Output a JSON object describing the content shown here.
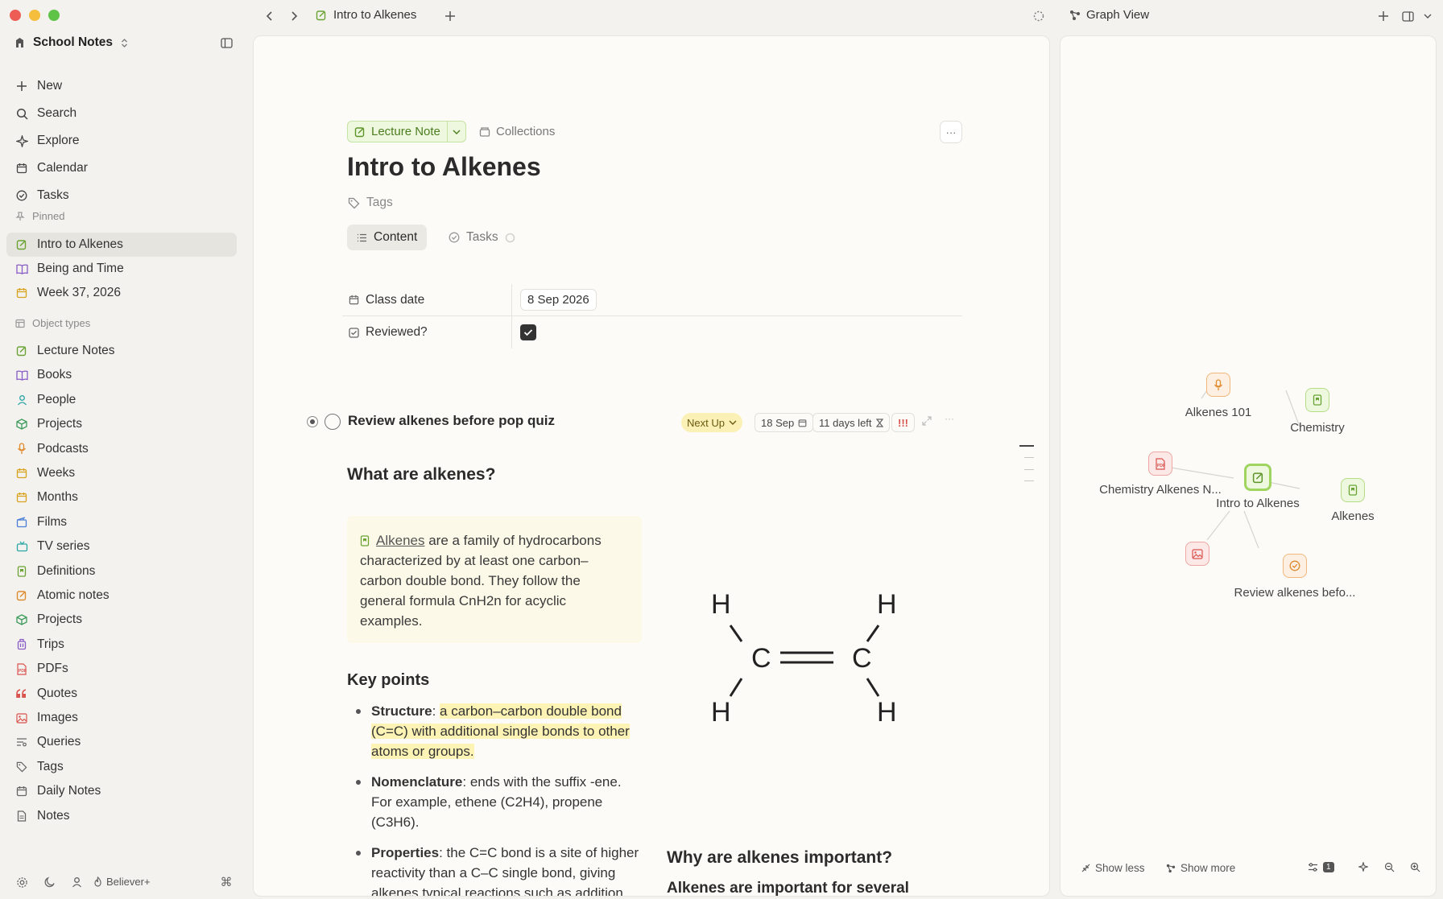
{
  "window": {
    "tab_title": "Intro to Alkenes",
    "graph_title": "Graph View"
  },
  "sidebar": {
    "workspace": "School Notes",
    "top_items": [
      {
        "label": "New",
        "icon": "plus-icon"
      },
      {
        "label": "Search",
        "icon": "search-icon"
      },
      {
        "label": "Explore",
        "icon": "sparkle-icon"
      },
      {
        "label": "Calendar",
        "icon": "calendar-icon"
      },
      {
        "label": "Tasks",
        "icon": "check-circle-icon"
      }
    ],
    "pinned_label": "Pinned",
    "pinned": [
      {
        "label": "Intro to Alkenes",
        "icon": "note-icon",
        "color": "#6aa334"
      },
      {
        "label": "Being and Time",
        "icon": "book-icon",
        "color": "#8a5cc7"
      },
      {
        "label": "Week 37, 2026",
        "icon": "calendar-icon",
        "color": "#d9a21e"
      }
    ],
    "object_types_label": "Object types",
    "object_types": [
      {
        "label": "Lecture Notes",
        "icon": "note-icon",
        "color": "#6aa334"
      },
      {
        "label": "Books",
        "icon": "book-icon",
        "color": "#8a5cc7"
      },
      {
        "label": "People",
        "icon": "person-icon",
        "color": "#2aa6a6"
      },
      {
        "label": "Projects",
        "icon": "cube-icon",
        "color": "#3c9a5a"
      },
      {
        "label": "Podcasts",
        "icon": "mic-icon",
        "color": "#e08a2e"
      },
      {
        "label": "Weeks",
        "icon": "calendar-icon",
        "color": "#d9a21e"
      },
      {
        "label": "Months",
        "icon": "calendar-icon",
        "color": "#d9a21e"
      },
      {
        "label": "Films",
        "icon": "film-icon",
        "color": "#4a7fd6"
      },
      {
        "label": "TV series",
        "icon": "tv-icon",
        "color": "#2aa6a6"
      },
      {
        "label": "Definitions",
        "icon": "bookmark-icon",
        "color": "#6aa334"
      },
      {
        "label": "Atomic notes",
        "icon": "note-icon",
        "color": "#e08a2e"
      },
      {
        "label": "Projects",
        "icon": "cube-icon",
        "color": "#3c9a5a"
      },
      {
        "label": "Trips",
        "icon": "luggage-icon",
        "color": "#8a5cc7"
      },
      {
        "label": "PDFs",
        "icon": "pdf-icon",
        "color": "#d9534f"
      },
      {
        "label": "Quotes",
        "icon": "quote-icon",
        "color": "#d9534f"
      },
      {
        "label": "Images",
        "icon": "image-icon",
        "color": "#d9534f"
      },
      {
        "label": "Queries",
        "icon": "query-icon",
        "color": "#666666"
      },
      {
        "label": "Tags",
        "icon": "tag-icon",
        "color": "#666666"
      },
      {
        "label": "Daily Notes",
        "icon": "calendar-icon",
        "color": "#666666"
      },
      {
        "label": "Notes",
        "icon": "doc-icon",
        "color": "#666666"
      }
    ],
    "footer_plan": "Believer+"
  },
  "note": {
    "type_label": "Lecture Note",
    "collections_label": "Collections",
    "title": "Intro to Alkenes",
    "tags_label": "Tags",
    "tab_content": "Content",
    "tab_tasks": "Tasks",
    "properties": [
      {
        "key": "Class date",
        "value": "8 Sep 2026"
      },
      {
        "key": "Reviewed?",
        "value": ""
      }
    ],
    "task": {
      "title": "Review alkenes before pop quiz",
      "status": "Next Up",
      "due": "18 Sep",
      "days_left": "11 days left",
      "priority": "!!!"
    },
    "h_what": "What are alkenes?",
    "callout": {
      "link": "Alkenes",
      "text": " are a family of hydrocarbons characterized by at least one carbon–carbon double bond. They follow the general formula CnH2n for acyclic examples."
    },
    "h_key": "Key points",
    "bullets": [
      {
        "label": "Structure",
        "sep": ": ",
        "text": "a carbon–carbon double bond (C=C) with additional single bonds to other atoms or groups."
      },
      {
        "label": "Nomenclature",
        "sep": ": ",
        "text": "ends with the suffix -ene. For example, ethene (C2H4), propene (C3H6)."
      },
      {
        "label": "Properties",
        "sep": ": ",
        "text": "the C=C bond is a site of higher reactivity than a C–C single bond, giving alkenes typical reactions such as addition across the double bond. They are"
      }
    ],
    "molecule": {
      "atoms": [
        "H",
        "H",
        "C",
        "C",
        "H",
        "H"
      ]
    },
    "h_why": "Why are alkenes important?",
    "h_why_sub": "Alkenes are important for several reasons:"
  },
  "graph": {
    "nodes": [
      {
        "label": "Alkenes 101",
        "icon": "mic-icon"
      },
      {
        "label": "Chemistry",
        "icon": "bookmark-icon"
      },
      {
        "label": "Chemistry Alkenes N...",
        "icon": "pdf-icon"
      },
      {
        "label": "Intro to Alkenes",
        "icon": "note-icon"
      },
      {
        "label": "Alkenes",
        "icon": "bookmark-icon"
      },
      {
        "label": "",
        "icon": "image-icon"
      },
      {
        "label": "Review alkenes befo...",
        "icon": "check-circle-icon"
      }
    ],
    "show_less": "Show less",
    "show_more": "Show more",
    "filter_count": "1"
  }
}
